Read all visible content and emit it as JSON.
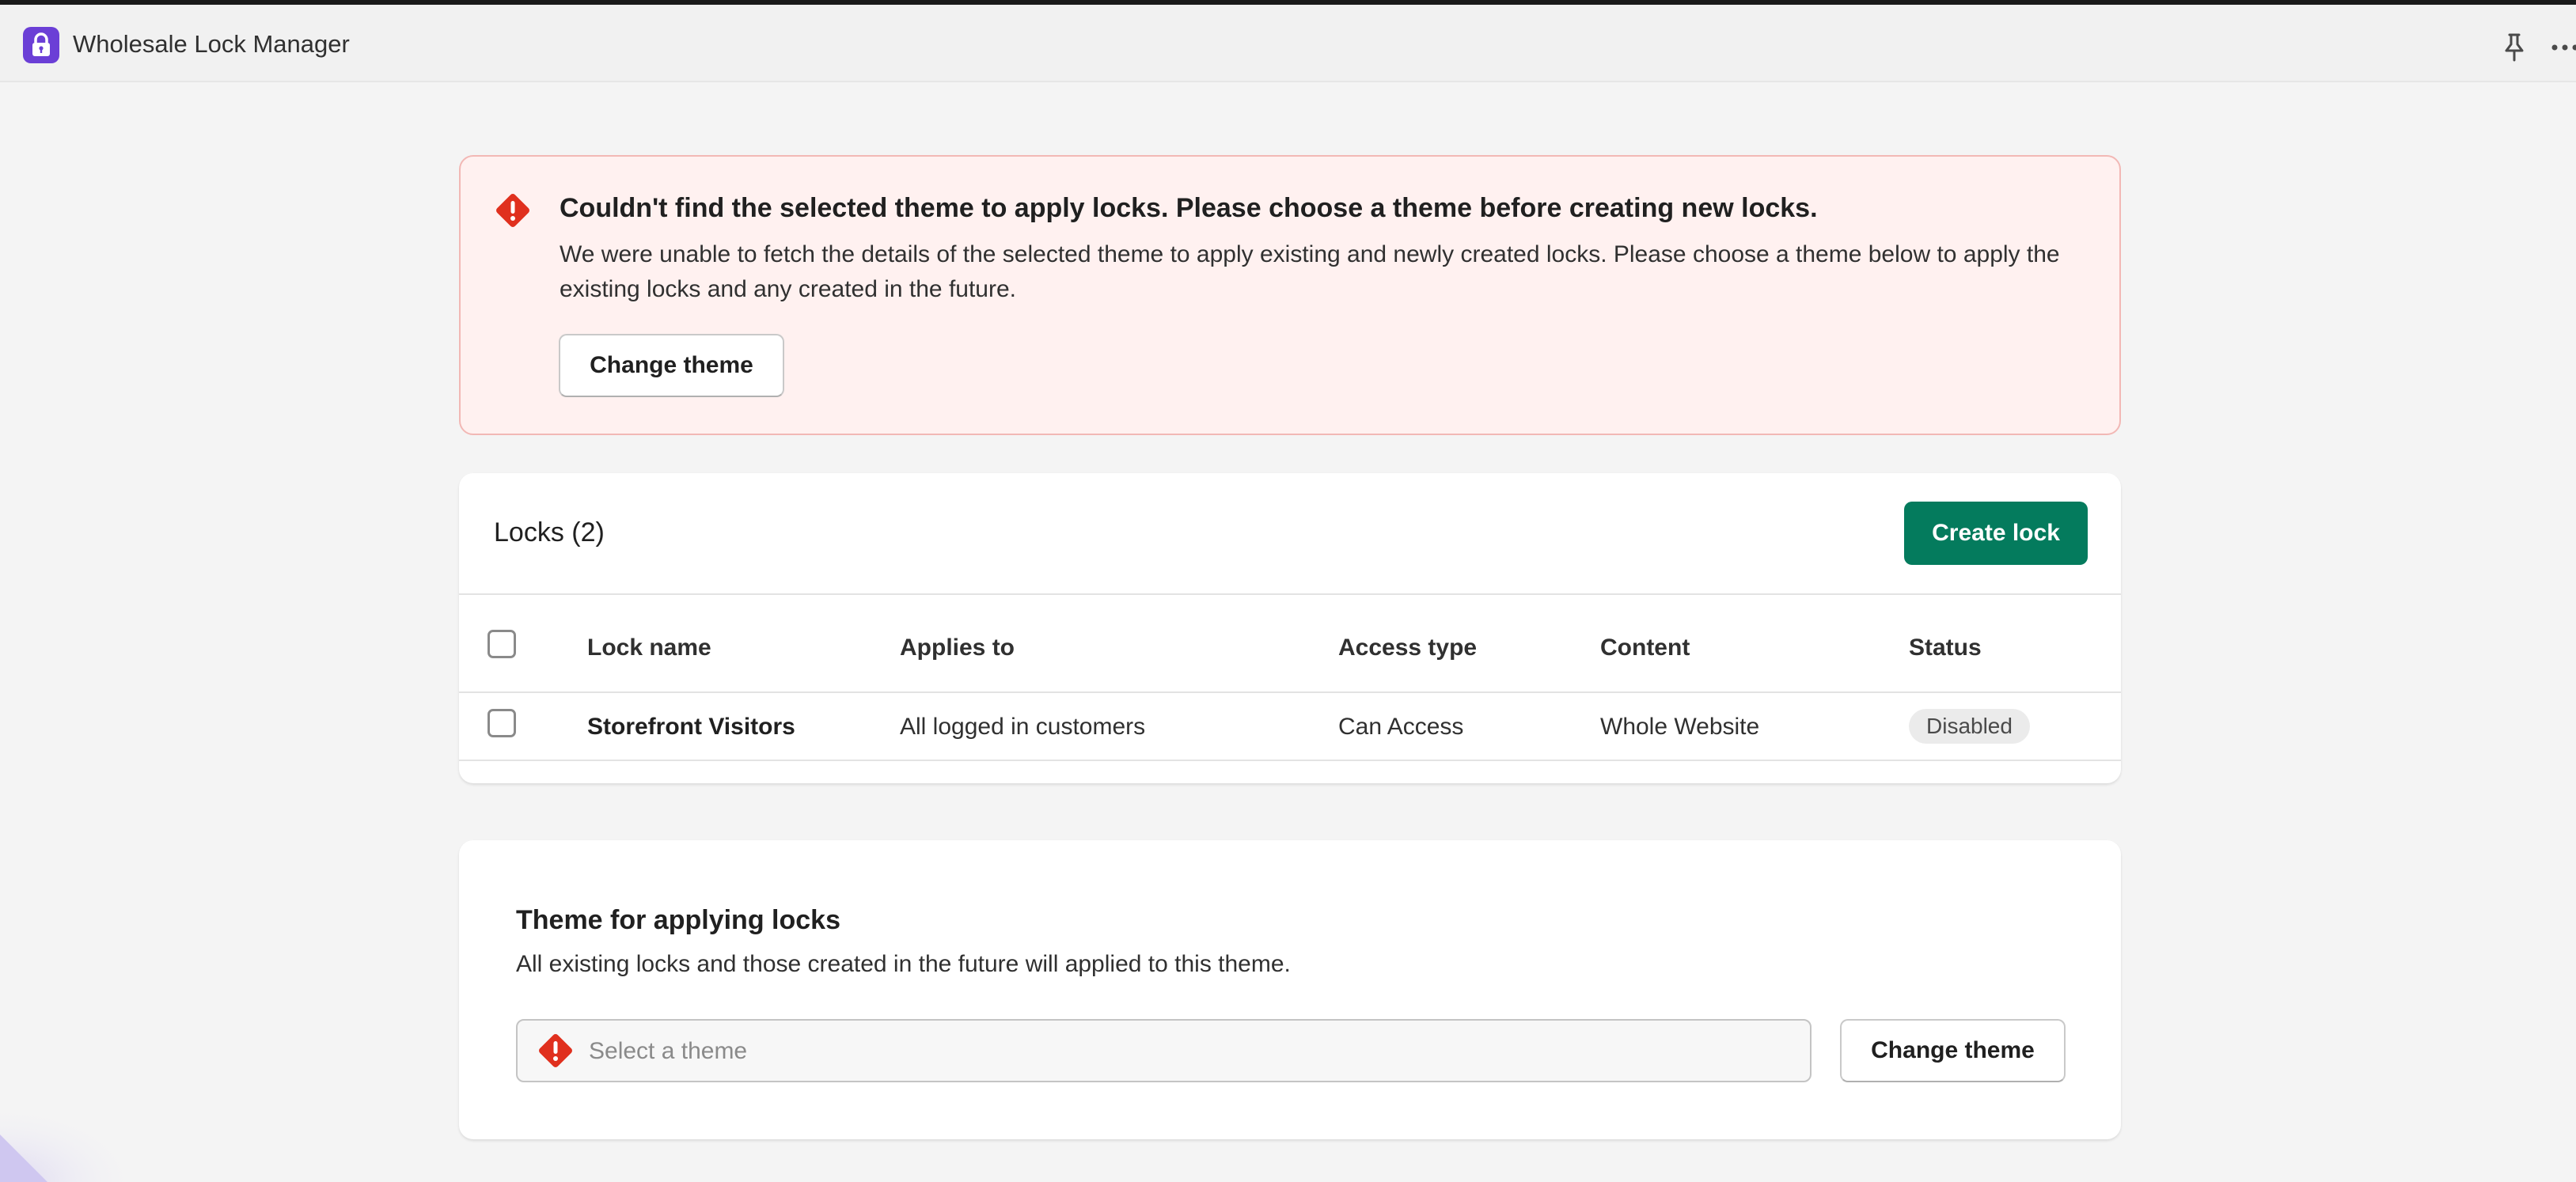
{
  "app": {
    "title": "Wholesale Lock Manager",
    "logo_icon": "lock-icon",
    "accent_color": "#6b3fd6"
  },
  "banner": {
    "icon": "error-diamond-icon",
    "title": "Couldn't find the selected theme to apply locks. Please choose a theme before creating new locks.",
    "body": "We were unable to fetch the details of the selected theme to apply existing and newly created locks. Please choose a theme below to apply the existing locks and any created in the future.",
    "button_label": "Change theme",
    "background_color": "#fff1f0",
    "border_color": "#f2b8b5",
    "icon_color": "#e0301e"
  },
  "locks": {
    "title": "Locks (2)",
    "create_button_label": "Create lock",
    "create_button_color": "#047b5d",
    "columns": [
      "Lock name",
      "Applies to",
      "Access type",
      "Content",
      "Status"
    ],
    "rows": [
      {
        "name": "Storefront Visitors",
        "applies_to": "All logged in customers",
        "access_type": "Can Access",
        "content": "Whole Website",
        "status": "Disabled"
      }
    ]
  },
  "theme": {
    "title": "Theme for applying locks",
    "description": "All existing locks and those created in the future will applied to this theme.",
    "select_placeholder": "Select a theme",
    "select_icon": "error-diamond-icon",
    "button_label": "Change theme"
  }
}
